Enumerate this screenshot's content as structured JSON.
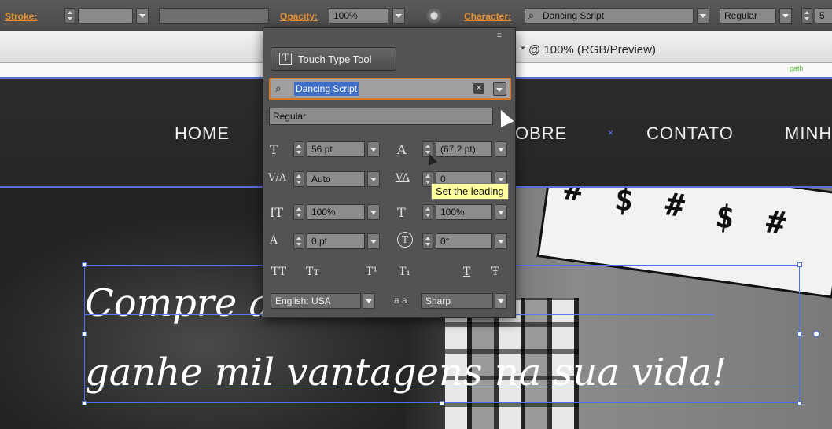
{
  "control_bar": {
    "stroke_label": "Stroke:",
    "opacity_label": "Opacity:",
    "opacity_value": "100%",
    "character_label": "Character:",
    "font_value": "Dancing Script",
    "style_value": "Regular",
    "trailing_value": "5"
  },
  "document": {
    "tab_title": "* @ 100% (RGB/Preview)",
    "path_label": "path"
  },
  "site": {
    "nav": [
      "HOME",
      "OBRE",
      "CONTATO",
      "MINH"
    ],
    "nav_dot": "×",
    "headline_line1": "Compre a      camisetas e",
    "headline_line2": "ganhe mil vantagens na sua vida!"
  },
  "character_panel": {
    "menu_icon": "≡",
    "touch_type_label": "Touch Type Tool",
    "font_search_value": "Dancing Script",
    "font_style_value": "Regular",
    "font_size": "56 pt",
    "leading": "(67.2 pt)",
    "kerning": "Auto",
    "tracking": "0",
    "vertical_scale": "100%",
    "horizontal_scale": "100%",
    "baseline_shift": "0 pt",
    "rotation": "0°",
    "glyph_buttons": [
      "TT",
      "Tт",
      "T¹",
      "T₁",
      "T",
      "Ŧ"
    ],
    "language": "English: USA",
    "antialias_icon": "a a",
    "antialias_value": "Sharp",
    "tooltip": "Set the leading"
  },
  "colors": {
    "accent_orange": "#e8912e",
    "selection_blue": "#4d6fe8",
    "panel_bg": "#535353"
  }
}
